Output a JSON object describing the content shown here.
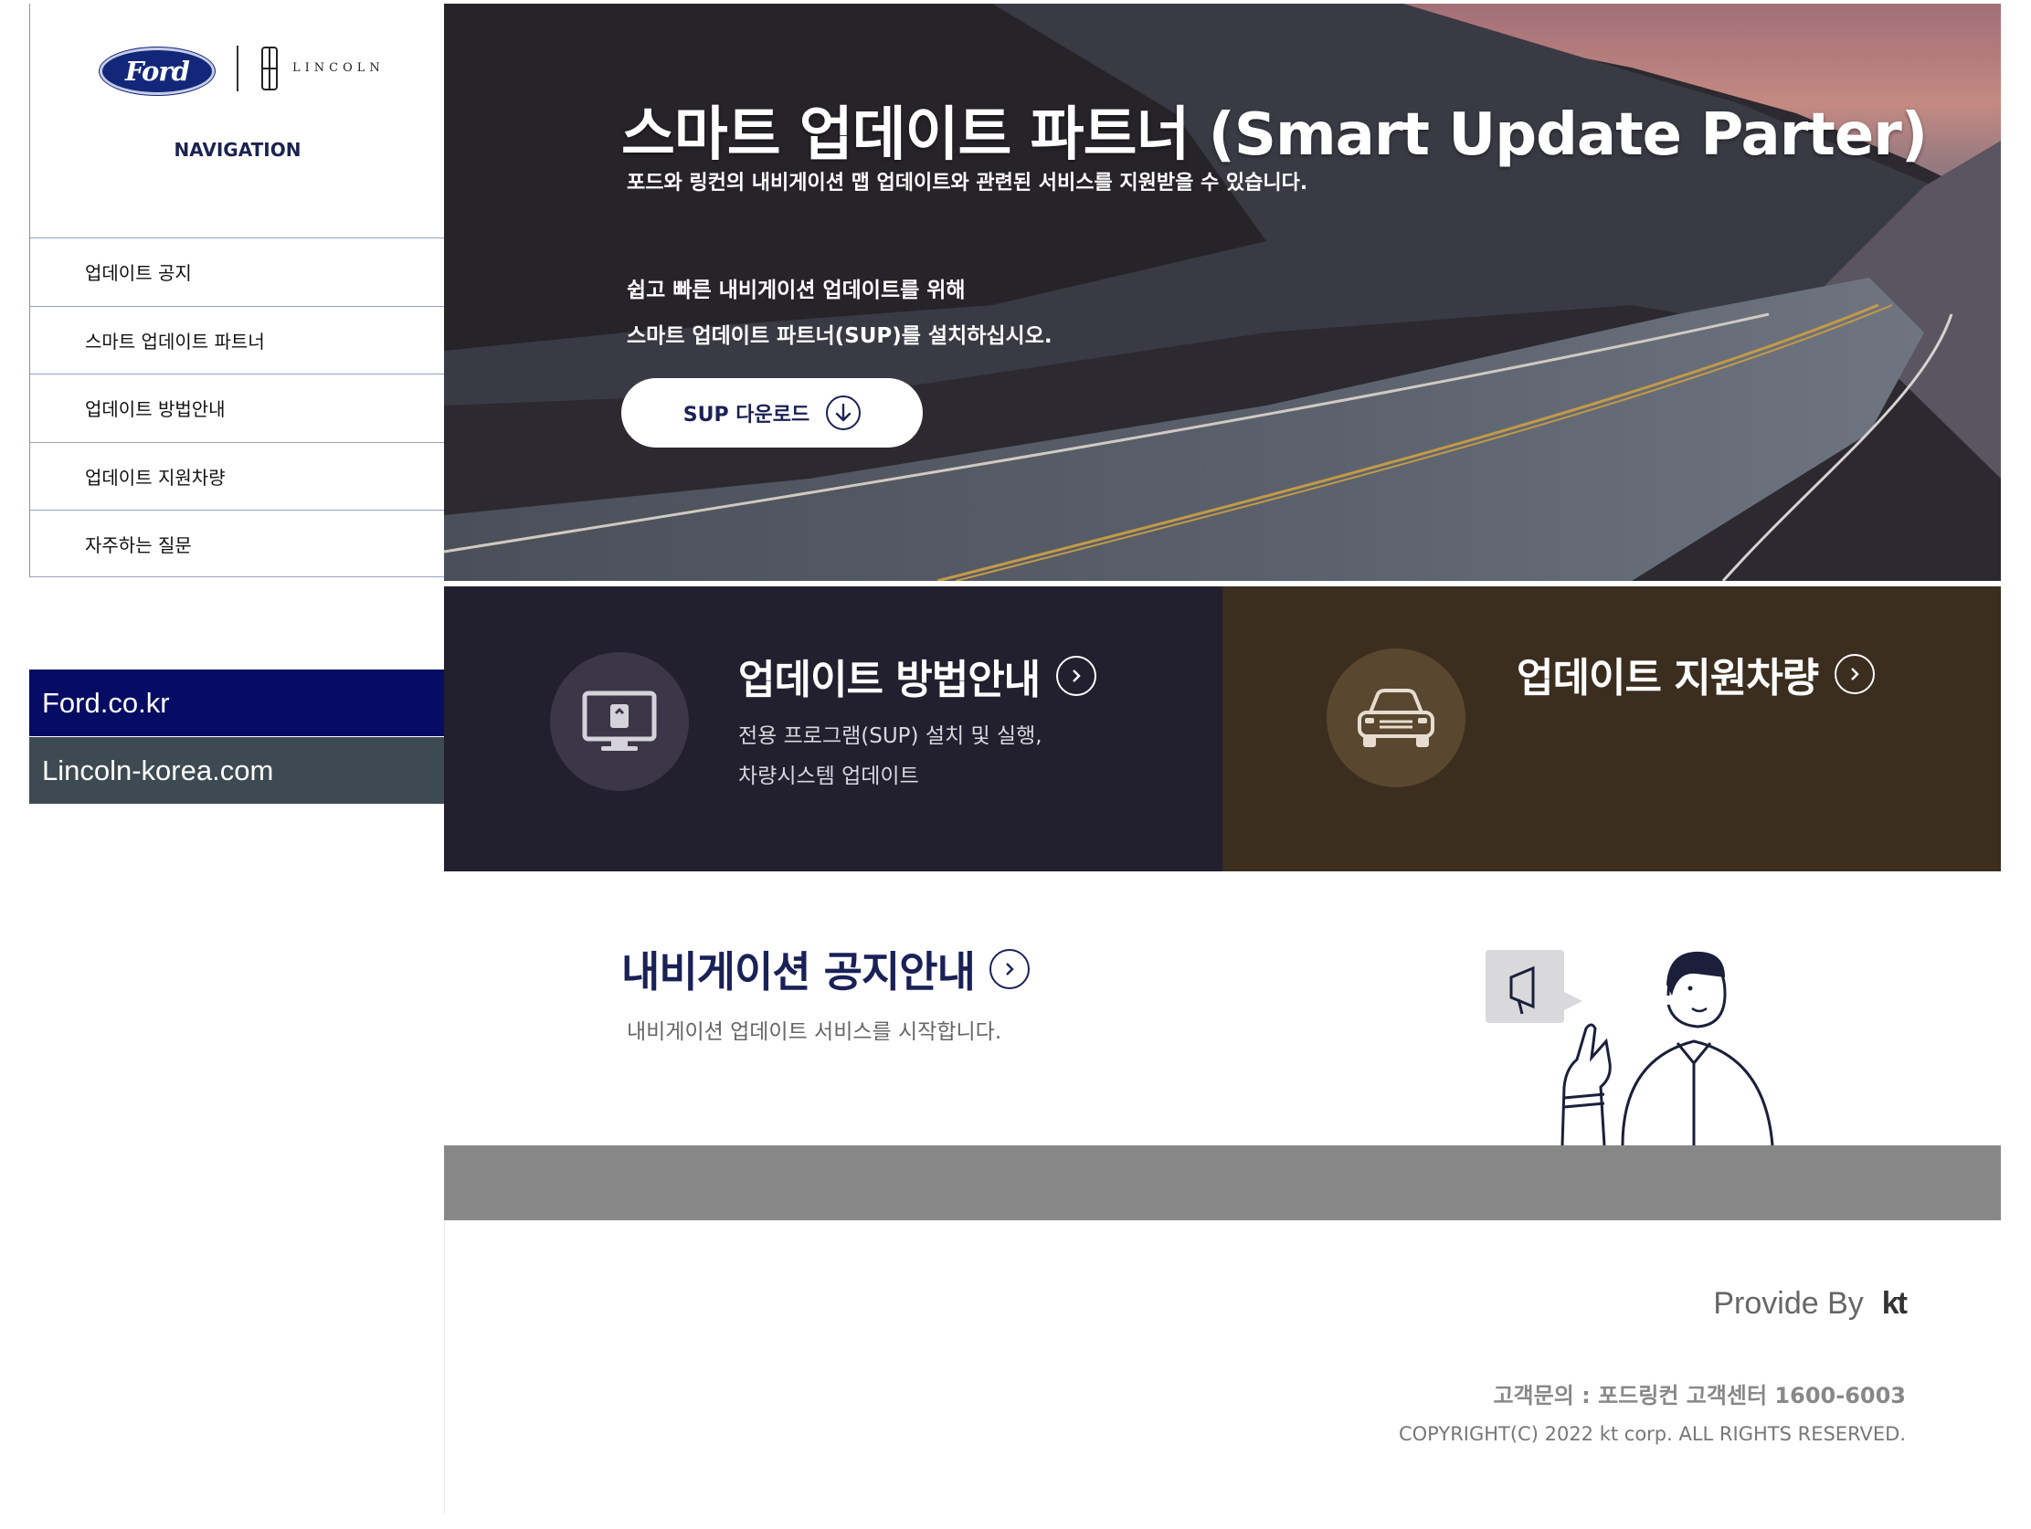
{
  "brand": {
    "ford": "Ford",
    "lincoln": "LINCOLN",
    "nav_title": "NAVIGATION"
  },
  "sidebar": {
    "items": [
      {
        "label": "업데이트 공지"
      },
      {
        "label": "스마트 업데이트 파트너"
      },
      {
        "label": "업데이트 방법안내"
      },
      {
        "label": "업데이트 지원차량"
      },
      {
        "label": "자주하는 질문"
      }
    ],
    "links": [
      {
        "label": "Ford.co.kr",
        "color": "#060c63"
      },
      {
        "label": "Lincoln-korea.com",
        "color": "#3e4a52"
      }
    ]
  },
  "hero": {
    "title": "스마트 업데이트 파트너 (Smart Update Parter)",
    "subtitle": "포드와 링컨의 내비게이션 맵 업데이트와 관련된 서비스를 지원받을 수 있습니다.",
    "desc_line1": "쉽고 빠른 내비게이션 업데이트를 위해",
    "desc_line2": "스마트 업데이트 파트너(SUP)를 설치하십시오.",
    "download_label": "SUP 다운로드"
  },
  "tiles": {
    "guide": {
      "title": "업데이트 방법안내",
      "desc_line1": "전용 프로그램(SUP) 설치 및 실행,",
      "desc_line2": "차량시스템 업데이트",
      "icon": "monitor-icon",
      "bg": "#221f2e"
    },
    "cars": {
      "title": "업데이트 지원차량",
      "icon": "car-icon",
      "bg": "#3b2e1f"
    }
  },
  "notice": {
    "title": "내비게이션 공지안내",
    "desc": "내비게이션 업데이트 서비스를 시작합니다."
  },
  "footer": {
    "provide_by": "Provide By",
    "provider_logo": "kt",
    "contact": "고객문의 : 포드링컨 고객센터 1600-6003",
    "copyright": "COPYRIGHT(C) 2022 kt corp. ALL RIGHTS RESERVED."
  }
}
